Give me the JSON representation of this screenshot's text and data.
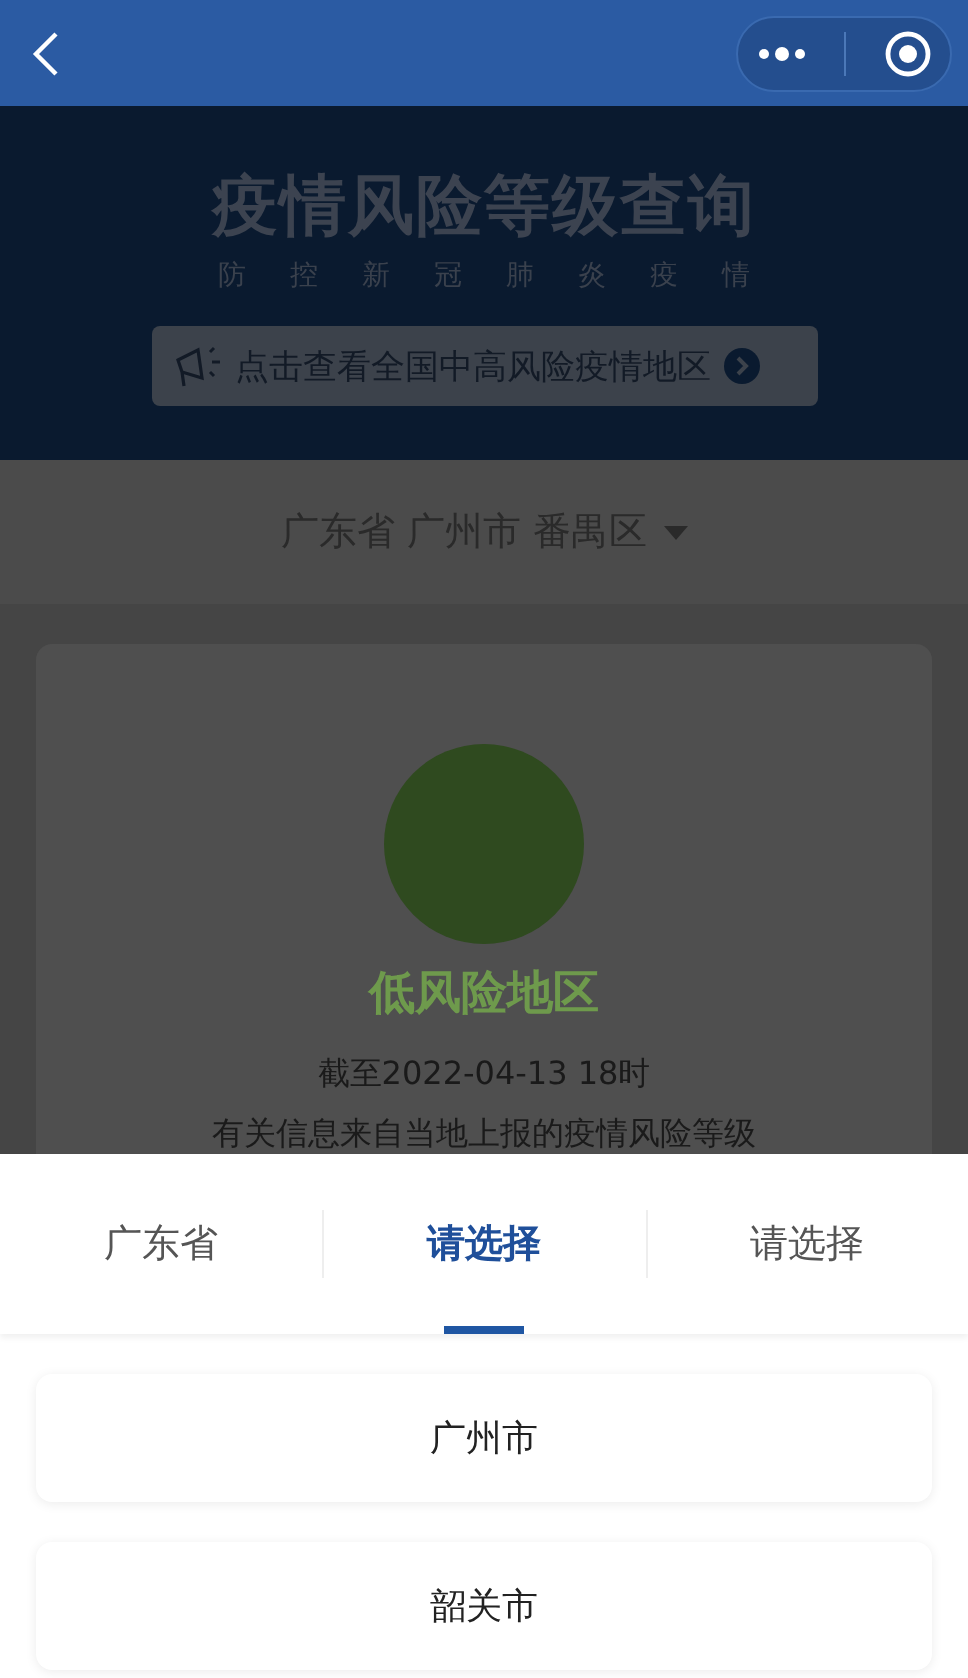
{
  "banner": {
    "title": "疫情风险等级查询",
    "subtitle": "防控新冠肺炎疫情",
    "notice_button": "点击查看全国中高风险疫情地区"
  },
  "region_selector": {
    "label": "广东省 广州市 番禺区"
  },
  "risk_card": {
    "level": "低风险地区",
    "updated": "截至2022-04-13 18时",
    "note": "有关信息来自当地上报的疫情风险等级"
  },
  "picker": {
    "tabs": [
      {
        "label": "广东省",
        "selected": false
      },
      {
        "label": "请选择",
        "selected": true
      },
      {
        "label": "请选择",
        "selected": false
      }
    ],
    "options": [
      {
        "label": "广州市"
      },
      {
        "label": "韶关市"
      }
    ]
  }
}
